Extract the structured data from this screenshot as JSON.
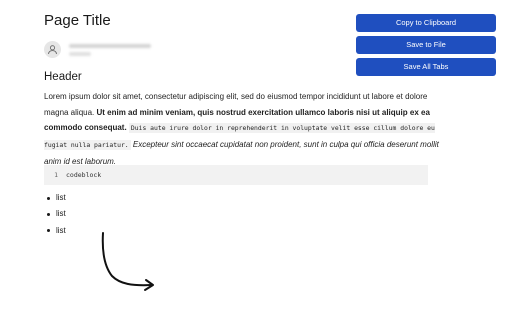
{
  "page": {
    "title": "Page Title"
  },
  "author": {
    "avatar_icon": "user-avatar-icon",
    "name_blurred": true
  },
  "section": {
    "header": "Header"
  },
  "paragraph": {
    "part1": "Lorem ipsum dolor sit amet, consectetur adipiscing elit, sed do eiusmod tempor incididunt ut labore et dolore magna aliqua. ",
    "bold": "Ut enim ad minim veniam, quis nostrud exercitation ullamco laboris nisi ut aliquip ex ea commodo consequat.",
    "code": "Duis aute irure dolor in reprehenderit in voluptate velit esse cillum dolore eu fugiat nulla pariatur.",
    "italic": "Excepteur sint occaecat cupidatat non proident, sunt in culpa qui officia deserunt mollit anim id est laborum."
  },
  "codeblock": {
    "line_number": "1",
    "code": "codeblock"
  },
  "list": {
    "items": [
      "list",
      "list",
      "list"
    ]
  },
  "actions": {
    "copy_label": "Copy to Clipboard",
    "save_file_label": "Save to File",
    "save_tabs_label": "Save All Tabs"
  },
  "colors": {
    "button_bg": "#1f4fbf",
    "button_text": "#ffffff",
    "codeblock_bg": "#f2f2f2"
  },
  "decoration": {
    "arrow_icon": "hand-drawn-arrow-icon"
  }
}
